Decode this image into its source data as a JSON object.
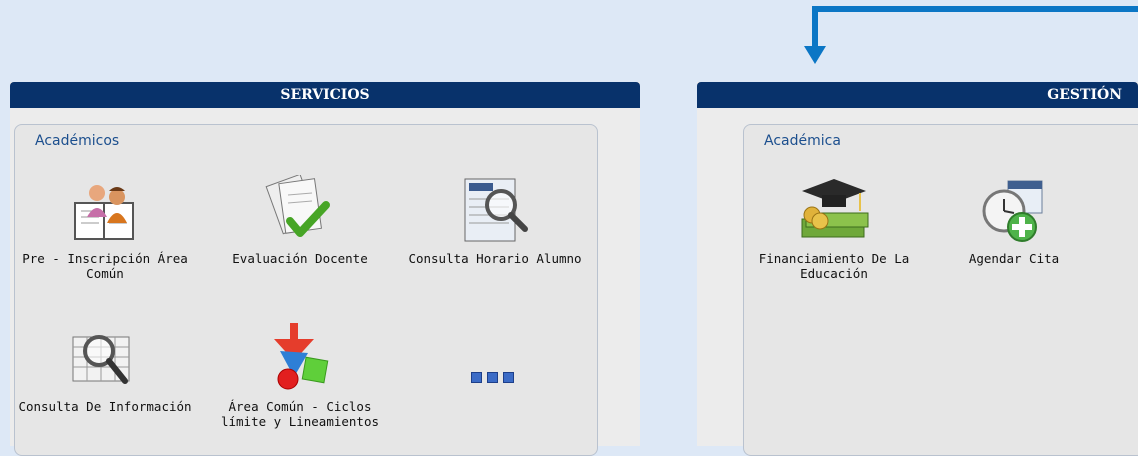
{
  "services": {
    "header": "SERVICIOS",
    "section_title": "Académicos",
    "items": [
      {
        "label": "Pre - Inscripción Área Común",
        "icon": "students-book-icon"
      },
      {
        "label": "Evaluación Docente",
        "icon": "evaluation-checkmark-icon"
      },
      {
        "label": "Consulta Horario Alumno",
        "icon": "schedule-magnifier-icon"
      },
      {
        "label": "Consulta De Información",
        "icon": "spreadsheet-magnifier-icon"
      },
      {
        "label": "Área Común - Ciclos límite y Lineamientos",
        "icon": "shapes-arrow-icon"
      }
    ]
  },
  "gestion": {
    "header": "GESTIÓN",
    "section_title": "Académica",
    "items": [
      {
        "label": "Financiamiento De La Educación",
        "icon": "graduation-money-icon"
      },
      {
        "label": "Agendar Cita",
        "icon": "clock-calendar-add-icon"
      }
    ]
  },
  "colors": {
    "accent": "#0b76c5",
    "header": "#08326b"
  }
}
